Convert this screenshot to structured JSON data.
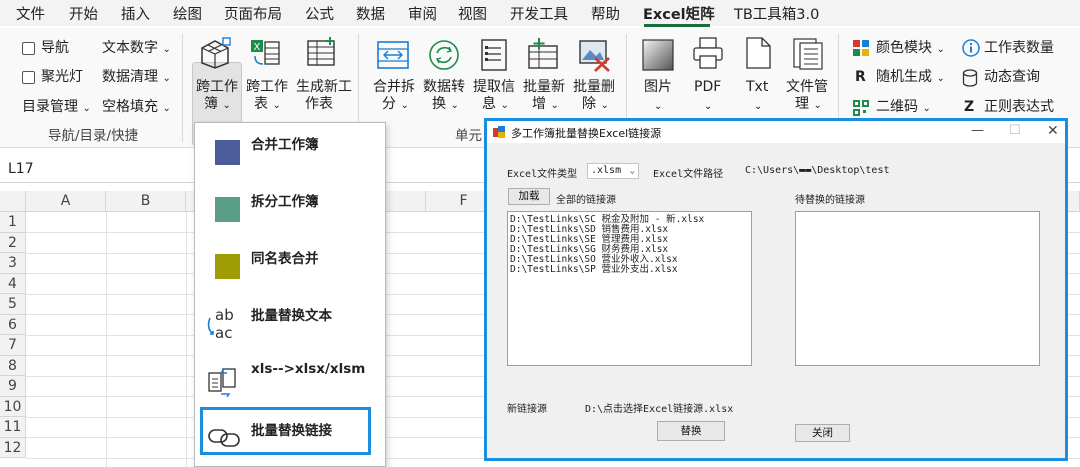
{
  "menu_tabs": [
    "文件",
    "开始",
    "插入",
    "绘图",
    "页面布局",
    "公式",
    "数据",
    "审阅",
    "视图",
    "开发工具",
    "帮助",
    "Excel矩阵",
    "TB工具箱3.0"
  ],
  "ribbon": {
    "nav_group": {
      "items": [
        "导航",
        "聚光灯",
        "目录管理"
      ],
      "items2": [
        "文本数字",
        "数据清理",
        "空格填充"
      ],
      "label": "导航/目录/快捷"
    },
    "workbook_buttons": [
      {
        "line1": "跨工作",
        "line2": "簿"
      },
      {
        "line1": "跨工作",
        "line2": "表"
      },
      {
        "line1": "生成新工",
        "line2": "作表"
      }
    ],
    "cell_buttons": [
      {
        "line1": "合并拆",
        "line2": "分"
      },
      {
        "line1": "数据转",
        "line2": "换"
      },
      {
        "line1": "提取信",
        "line2": "息"
      },
      {
        "line1": "批量新",
        "line2": "增"
      },
      {
        "line1": "批量删",
        "line2": "除"
      }
    ],
    "cell_group_label": "单元",
    "media_buttons": [
      "图片",
      "PDF",
      "Txt"
    ],
    "file_button": {
      "line1": "文件管",
      "line2": "理"
    },
    "right_items": [
      "颜色模块",
      "随机生成",
      "二维码"
    ],
    "right_items2": [
      "工作表数量",
      "动态查询",
      "正则表达式"
    ]
  },
  "namebox": "L17",
  "columns": [
    "A",
    "B",
    "F"
  ],
  "rows": [
    "1",
    "2",
    "3",
    "4",
    "5",
    "6",
    "7",
    "8",
    "9",
    "10",
    "11",
    "12"
  ],
  "dropdown": {
    "items": [
      {
        "label": "合并工作簿",
        "color": "#4a5c9a"
      },
      {
        "label": "拆分工作簿",
        "color": "#5a9e8a"
      },
      {
        "label": "同名表合并",
        "color": "#a09c05"
      },
      {
        "label": "批量替换文本",
        "icon": "ab-ac-replace-icon"
      },
      {
        "label": "xls-->xlsx/xlsm",
        "icon": "file-convert-icon"
      },
      {
        "label": "批量替换链接",
        "icon": "link-icon"
      }
    ]
  },
  "dialog": {
    "title": "多工作簿批量替换Excel链接源",
    "file_type_label": "Excel文件类型",
    "file_type_value": ".xlsm",
    "file_path_label": "Excel文件路径",
    "file_path_value": "C:\\Users\\▬▬\\Desktop\\test",
    "load_button": "加载",
    "all_sources_label": "全部的链接源",
    "pending_label": "待替换的链接源",
    "sources": [
      "D:\\TestLinks\\SC 税金及附加 - 新.xlsx",
      "D:\\TestLinks\\SD 销售费用.xlsx",
      "D:\\TestLinks\\SE 管理费用.xlsx",
      "D:\\TestLinks\\SG 财务费用.xlsx",
      "D:\\TestLinks\\SO 营业外收入.xlsx",
      "D:\\TestLinks\\SP 营业外支出.xlsx"
    ],
    "new_source_label": "新链接源",
    "new_source_value": "D:\\点击选择Excel链接源.xlsx",
    "replace_button": "替换",
    "close_button": "关闭"
  }
}
